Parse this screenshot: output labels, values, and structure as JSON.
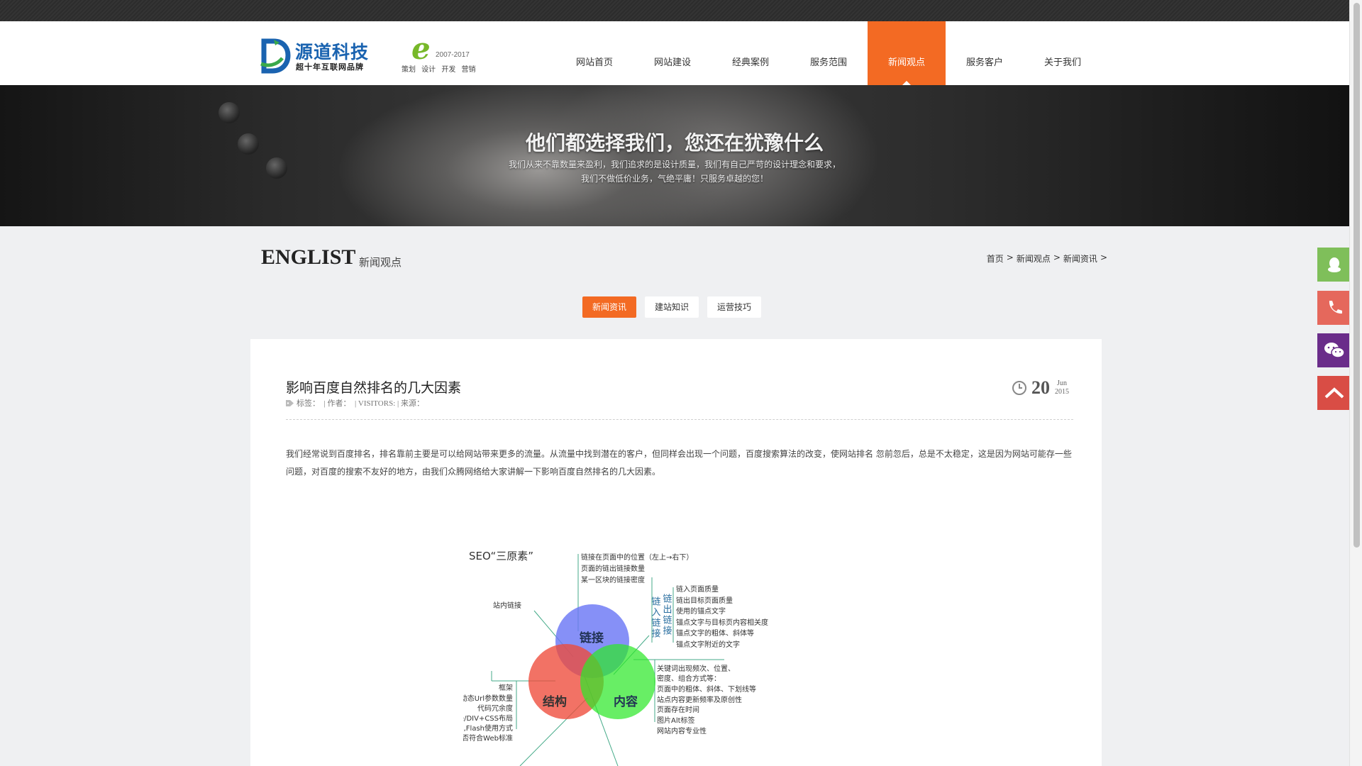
{
  "header": {
    "logo_title": "源道科技",
    "logo_subtitle": "超十年互联网品牌",
    "emark_years": "2007-2017",
    "emark_words": "策划 设计 开发 营销"
  },
  "nav": [
    {
      "label": "网站首页"
    },
    {
      "label": "网站建设"
    },
    {
      "label": "经典案例"
    },
    {
      "label": "服务范围"
    },
    {
      "label": "新闻观点",
      "active": true
    },
    {
      "label": "服务客户"
    },
    {
      "label": "关于我们"
    }
  ],
  "banner": {
    "title": "他们都选择我们，您还在犹豫什么",
    "line1": "我们从来不靠数量来盈利，我们追求的是设计质量，我们有自己严苛的设计理念和要求，",
    "line2": "我们不做低价业务，气绝平庸！只服务卓越的您！"
  },
  "section": {
    "title": "ENGLIST",
    "subtitle": "新闻观点"
  },
  "breadcrumb": [
    {
      "label": "首页"
    },
    {
      "label": "新闻观点"
    },
    {
      "label": "新闻资讯"
    }
  ],
  "breadcrumb_sep": ">",
  "subtabs": [
    {
      "label": "新闻资讯",
      "active": true
    },
    {
      "label": "建站知识"
    },
    {
      "label": "运营技巧"
    }
  ],
  "article": {
    "title": "影响百度自然排名的几大因素",
    "meta": "标签：　| 作者：　| VISITORS: | 来源：",
    "date_day": "20",
    "date_month": "Jun",
    "date_year": "2015",
    "body": "我们经常说到百度排名，排名靠前主要是可以给网站带来更多的流量。从流量中找到潜在的客户，但同样会出现一个问题，百度搜索算法的改变，使网站排名 忽前忽后，总是不太稳定，这是因为网站可能存一些问题，对百度的搜索不友好的地方，由我们众腾网络给大家讲解一下影响百度自然排名的几大因素。"
  },
  "diagram": {
    "heading": "SEO“三原素”",
    "circle_links": "链接",
    "circle_structure": "结构",
    "circle_content": "内容",
    "links_top": [
      "链接在页面中的位置（左上→右下）",
      "页面的链出链接数量",
      "某一区块的链接密度"
    ],
    "internal_link": "站内链接",
    "inbound_label": "链入链接",
    "outbound_label": "链出链接",
    "links_right": [
      "链入页面质量",
      "链出目标页面质量",
      "使用的锚点文字",
      "锚点文字与目标页内容相关度",
      "锚点文字的粗体、斜体等",
      "锚点文字附近的文字"
    ],
    "content_right": [
      "关键词出现频次、位置、",
      "密度、组合方式等：",
      "页面中的粗体、斜体、下划线等",
      "站点内容更新频率及原创性",
      "页面存在时间",
      "图片Alt标签",
      "网站内容专业性"
    ],
    "structure_left": [
      "框架",
      "动态Url参数数量",
      "代码冗余度",
      "Table/DIV+CSS布局",
      "js,Flash使用方式",
      "代码是否符合Web标准"
    ]
  },
  "colors": {
    "accent": "#f36a23",
    "qq": "#7fbf5a",
    "phone": "#e5685c",
    "wechat": "#6a2d8a",
    "top": "#d94d45"
  }
}
